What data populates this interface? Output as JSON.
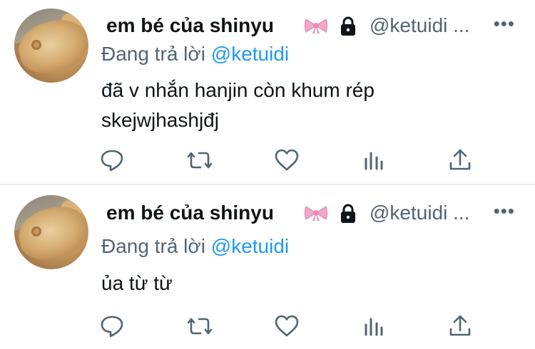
{
  "tweets": [
    {
      "author_name": "em bé của shinyu",
      "name_emoji": "bow",
      "locked_icon": "lock-icon",
      "handle": "@ketuidi ...",
      "more": "•••",
      "reply_prefix": "Đang trả lời",
      "reply_mention": "@ketuidi",
      "text_lines": [
        "đã v nhắn hanjin còn khum rép",
        "skejwjhashjđj"
      ]
    },
    {
      "author_name": "em bé của shinyu",
      "name_emoji": "bow",
      "locked_icon": "lock-icon",
      "handle": "@ketuidi ...",
      "more": "•••",
      "reply_prefix": "Đang trả lời",
      "reply_mention": "@ketuidi",
      "text_lines": [
        "ủa từ từ"
      ]
    }
  ],
  "actions": [
    "reply-icon",
    "retweet-icon",
    "like-icon",
    "analytics-icon",
    "share-icon"
  ],
  "colors": {
    "accent": "#1d9bf0",
    "muted": "#536471",
    "text": "#0f1419",
    "divider": "#e6ecf0",
    "bow": "#f4a6c8"
  }
}
